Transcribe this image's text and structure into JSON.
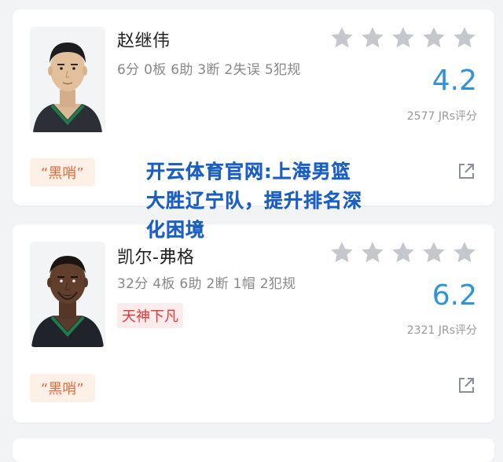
{
  "players": [
    {
      "name": "赵继伟",
      "stats": "6分 0板 6助 3断 2失误 5犯规",
      "tag": "",
      "stars": 5,
      "score": "4.2",
      "rating_count": "2577 JRs评分",
      "chip": "“黑哨”"
    },
    {
      "name": "凯尔-弗格",
      "stats": "32分 4板 6助 2断 1帽 2犯规",
      "tag": "天神下凡",
      "stars": 5,
      "score": "6.2",
      "rating_count": "2321 JRs评分",
      "chip": "“黑哨”"
    }
  ],
  "overlay_text": "开云体育官网:上海男篮大胜辽宁队，提升排名深化困境",
  "colors": {
    "score": "#2e93d8",
    "star_inactive": "#c4c7cc",
    "tag_text": "#e43838",
    "tag_bg": "#fdecec",
    "chip_text": "#e86a3a",
    "chip_bg": "#fdf0e6",
    "overlay_text": "#1b5fc6",
    "jersey": "#1f7a4c"
  },
  "icons": [
    "star-icon",
    "share-icon",
    "player-photo"
  ]
}
